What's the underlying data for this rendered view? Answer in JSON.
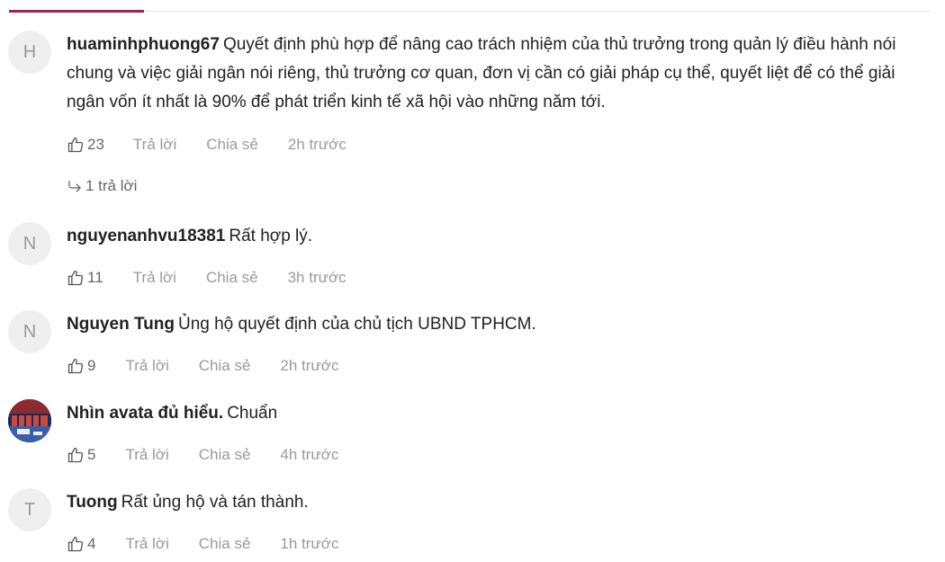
{
  "comments": [
    {
      "avatar_letter": "H",
      "author": "huaminhphuong67",
      "text": "Quyết định phù hợp để nâng cao trách nhiệm của thủ trưởng trong quản lý điều hành nói chung và việc giải ngân nói riêng, thủ trưởng cơ quan, đơn vị cần có giải pháp cụ thể, quyết liệt để có thể giải ngân vốn ít nhất là 90% để phát triển kinh tế xã hội vào những năm tới.",
      "likes": "23",
      "reply": "Trả lời",
      "share": "Chia sẻ",
      "time": "2h trước",
      "replies_label": "1 trả lời"
    },
    {
      "avatar_letter": "N",
      "author": "nguyenanhvu18381",
      "text": "Rất hợp lý.",
      "likes": "11",
      "reply": "Trả lời",
      "share": "Chia sẻ",
      "time": "3h trước"
    },
    {
      "avatar_letter": "N",
      "author": "Nguyen Tung",
      "text": "Ủng hộ quyết định của chủ tịch UBND TPHCM.",
      "likes": "9",
      "reply": "Trả lời",
      "share": "Chia sẻ",
      "time": "2h trước"
    },
    {
      "avatar_letter": "",
      "author": "Nhìn avata đủ hiểu.",
      "text": "Chuẩn",
      "likes": "5",
      "reply": "Trả lời",
      "share": "Chia sẻ",
      "time": "4h trước"
    },
    {
      "avatar_letter": "T",
      "author": "Tuong",
      "text": "Rất ủng hộ và tán thành.",
      "likes": "4",
      "reply": "Trả lời",
      "share": "Chia sẻ",
      "time": "1h trước"
    }
  ],
  "icons": {
    "like": "thumbs-up-icon",
    "reply_arrow": "reply-arrow-icon"
  },
  "colors": {
    "accent": "#9f224e",
    "muted": "#999999"
  }
}
